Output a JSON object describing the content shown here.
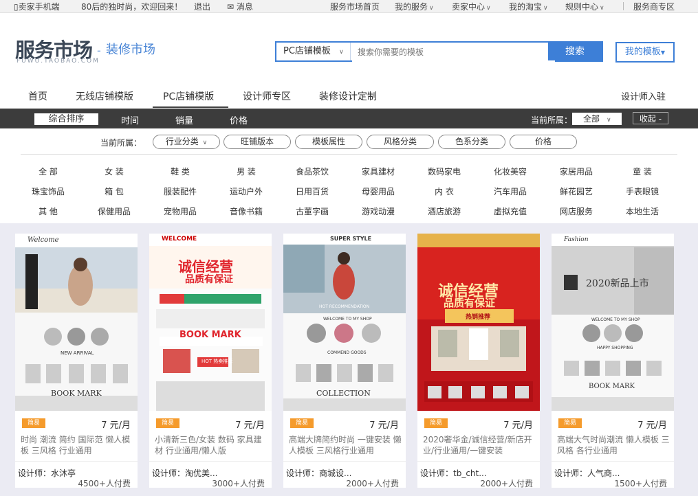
{
  "topbar": {
    "mobile": "卖家手机端",
    "welcome": "80后的独时尚，欢迎回来！",
    "logout": "退出",
    "message": "消息",
    "links": [
      "服务市场首页",
      "我的服务",
      "卖家中心",
      "我的淘宝",
      "规则中心",
      "服务商专区"
    ]
  },
  "header": {
    "logo_text": "服务市场",
    "logo_sub": "FUWU.TAOBAO.COM",
    "section_title": "装修市场",
    "search_type": "PC店铺模板",
    "search_placeholder": "搜索你需要的模板",
    "search_button": "搜索",
    "my_templates": "我的模板"
  },
  "nav": {
    "items": [
      "首页",
      "无线店铺模版",
      "PC店铺模版",
      "设计师专区",
      "装修设计定制"
    ],
    "join": "设计师入驻"
  },
  "sort": {
    "items": [
      "综合排序",
      "时间",
      "销量",
      "价格"
    ],
    "current_label": "当前所属：",
    "current_value": "全部",
    "collapse": "收起 -"
  },
  "filters": {
    "label": "当前所属：",
    "pills": [
      "行业分类",
      "旺铺版本",
      "模板属性",
      "风格分类",
      "色系分类",
      "价格"
    ]
  },
  "categories": [
    [
      "全 部",
      "女 装",
      "鞋 类",
      "男 装",
      "食品茶饮",
      "家具建材",
      "数码家电",
      "化妆美容",
      "家居用品",
      "童 装"
    ],
    [
      "珠宝饰品",
      "箱 包",
      "服装配件",
      "运动户外",
      "日用百货",
      "母婴用品",
      "内 衣",
      "汽车用品",
      "鲜花园艺",
      "手表眼镜"
    ],
    [
      "其 他",
      "保健用品",
      "宠物用品",
      "音像书籍",
      "古董字画",
      "游戏动漫",
      "酒店旅游",
      "虚拟充值",
      "网店服务",
      "本地生活"
    ]
  ],
  "cards": [
    {
      "tag": "简易",
      "price": "7 元/月",
      "desc": "时尚 潮流 简约 国际范 懒人模板 三风格 行业通用",
      "designer": "设计师：水沐亭",
      "pay": "4500+人付费",
      "thumb_texts": [
        "Welcome",
        "BOOK MARK",
        "NEW ARRIVAL"
      ]
    },
    {
      "tag": "简易",
      "price": "7 元/月",
      "desc": "小清新三色/女装 数码 家具建材 行业通用/懒人版",
      "designer": "设计师：淘优美...",
      "pay": "3000+人付费",
      "thumb_texts": [
        "WELCOME",
        "诚信经营",
        "品质有保证",
        "BOOK MARK",
        "HOT 热卖推荐"
      ]
    },
    {
      "tag": "简易",
      "price": "7 元/月",
      "desc": "高端大牌简约时尚 一键安装 懒人模板 三风格行业通用",
      "designer": "设计师：商城设...",
      "pay": "2000+人付费",
      "thumb_texts": [
        "SUPER STYLE",
        "HOT RECOMMENDATION",
        "WELCOME TO MY SHOP",
        "COMMEND GOODS",
        "COLLECTION"
      ]
    },
    {
      "tag": "简易",
      "price": "7 元/月",
      "desc": "2020奢华金/诚信经营/新店开业/行业通用/一键安装",
      "designer": "设计师：tb_cht...",
      "pay": "2000+人付费",
      "thumb_texts": [
        "诚信经营",
        "品质有保证",
        "热销推荐"
      ]
    },
    {
      "tag": "简易",
      "price": "7 元/月",
      "desc": "高端大气时尚潮流 懒人模板 三风格 各行业通用",
      "designer": "设计师：人气商...",
      "pay": "1500+人付费",
      "thumb_texts": [
        "Fashion",
        "2020新品上市",
        "WELCOME TO MY SHOP",
        "HAPPY SHOPPING",
        "BOOK MARK"
      ]
    }
  ],
  "colors": {
    "accent": "#3d7fd7",
    "sortbar": "#3c3c3c",
    "tag": "#f59b2c",
    "card_bg": "#ebebf3"
  }
}
